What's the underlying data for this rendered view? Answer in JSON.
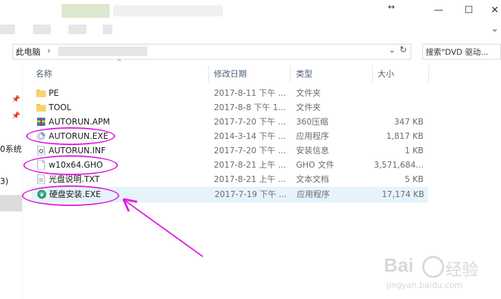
{
  "window": {
    "minimize_label": "—",
    "maximize_label": "☐",
    "close_label": "✕",
    "expand_label": "⌄",
    "resize_icon": "↔"
  },
  "address": {
    "path_root": "此电脑",
    "chevron": "›",
    "dropdown": "⌄",
    "refresh": "↻",
    "search_placeholder": "搜索\"DVD 驱动..."
  },
  "columns": {
    "name": "名称",
    "date": "修改日期",
    "type": "类型",
    "size": "大小"
  },
  "nav": {
    "partial_1": "0系统",
    "partial_2": "3)"
  },
  "files": [
    {
      "name": "PE",
      "date": "2017-8-11 下午 ...",
      "type": "文件夹",
      "size": "",
      "icon": "folder-icon"
    },
    {
      "name": "TOOL",
      "date": "2017-8-8 下午 1...",
      "type": "文件夹",
      "size": "",
      "icon": "folder-icon"
    },
    {
      "name": "AUTORUN.APM",
      "date": "2017-7-20 下午 ...",
      "type": "360压缩",
      "size": "347 KB",
      "icon": "archive-icon"
    },
    {
      "name": "AUTORUN.EXE",
      "date": "2014-3-14 下午 ...",
      "type": "应用程序",
      "size": "1,817 KB",
      "icon": "disc-app-icon"
    },
    {
      "name": "AUTORUN.INF",
      "date": "2017-7-20 下午 ...",
      "type": "安装信息",
      "size": "1 KB",
      "icon": "settings-file-icon"
    },
    {
      "name": "w10x64.GHO",
      "date": "2017-8-21 上午 ...",
      "type": "GHO 文件",
      "size": "3,571,684...",
      "icon": "file-icon"
    },
    {
      "name": "光盘说明.TXT",
      "date": "2017-8-21 上午 ...",
      "type": "文本文档",
      "size": "5 KB",
      "icon": "text-file-icon"
    },
    {
      "name": "硬盘安装.EXE",
      "date": "2017-7-19 下午 ...",
      "type": "应用程序",
      "size": "17,174 KB",
      "icon": "installer-icon"
    }
  ],
  "watermark": {
    "brand": "Bai",
    "brand2": "经验",
    "url": "jingyan.baidu.com"
  },
  "colors": {
    "annotation": "#e21ee0",
    "selection": "#e5f3fb",
    "folder": "#f3c24f",
    "header_text": "#4c607a"
  }
}
